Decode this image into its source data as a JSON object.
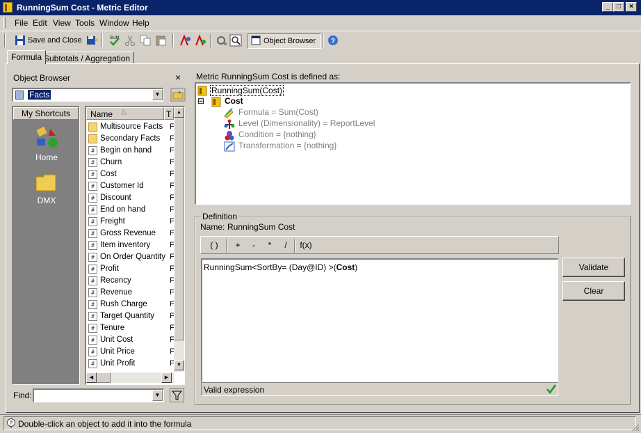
{
  "window": {
    "title": "RunningSum Cost - Metric Editor",
    "min_label": "_",
    "max_label": "□",
    "close_label": "×"
  },
  "menu": [
    {
      "label": "File"
    },
    {
      "label": "Edit"
    },
    {
      "label": "View"
    },
    {
      "label": "Tools"
    },
    {
      "label": "Window"
    },
    {
      "label": "Help"
    }
  ],
  "toolbar": {
    "save_close_label": "Save and Close",
    "object_browser_label": "Object Browser",
    "sum_label": "SUM"
  },
  "tabs": [
    {
      "label": "Formula",
      "active": true
    },
    {
      "label": "Subtotals / Aggregation",
      "active": false
    }
  ],
  "object_browser": {
    "title": "Object Browser",
    "close_label": "×",
    "folder_value": "Facts",
    "shortcuts_header": "My Shortcuts",
    "shortcuts": [
      {
        "label": "Home",
        "icon": "home-icon"
      },
      {
        "label": "DMX",
        "icon": "folder-icon"
      }
    ],
    "columns": [
      "Name",
      "T"
    ],
    "sort_glyph": "△",
    "items": [
      {
        "name": "Multisource Facts",
        "type": "F",
        "icon": "folder"
      },
      {
        "name": "Secondary Facts",
        "type": "F",
        "icon": "folder"
      },
      {
        "name": "Begin on hand",
        "type": "F",
        "icon": "fact"
      },
      {
        "name": "Churn",
        "type": "F",
        "icon": "fact"
      },
      {
        "name": "Cost",
        "type": "F",
        "icon": "fact"
      },
      {
        "name": "Customer Id",
        "type": "F",
        "icon": "fact"
      },
      {
        "name": "Discount",
        "type": "F",
        "icon": "fact"
      },
      {
        "name": "End on hand",
        "type": "F",
        "icon": "fact"
      },
      {
        "name": "Freight",
        "type": "F",
        "icon": "fact"
      },
      {
        "name": "Gross Revenue",
        "type": "F",
        "icon": "fact"
      },
      {
        "name": "Item inventory",
        "type": "F",
        "icon": "fact"
      },
      {
        "name": "On Order Quantity",
        "type": "F",
        "icon": "fact"
      },
      {
        "name": "Profit",
        "type": "F",
        "icon": "fact"
      },
      {
        "name": "Recency",
        "type": "F",
        "icon": "fact"
      },
      {
        "name": "Revenue",
        "type": "F",
        "icon": "fact"
      },
      {
        "name": "Rush Charge",
        "type": "F",
        "icon": "fact"
      },
      {
        "name": "Target Quantity",
        "type": "F",
        "icon": "fact"
      },
      {
        "name": "Tenure",
        "type": "F",
        "icon": "fact"
      },
      {
        "name": "Unit Cost",
        "type": "F",
        "icon": "fact"
      },
      {
        "name": "Unit Price",
        "type": "F",
        "icon": "fact"
      },
      {
        "name": "Unit Profit",
        "type": "F",
        "icon": "fact"
      }
    ],
    "fact_glyph": "#",
    "find_label": "Find:",
    "find_value": ""
  },
  "metric": {
    "header_prefix": "Metric",
    "name": "RunningSum Cost",
    "header_suffix": "is defined as:",
    "tree_root": "RunningSum(Cost)",
    "tree_toggle": "⊟",
    "tree_child": "Cost",
    "properties": [
      {
        "label": "Formula = Sum(Cost)",
        "icon": "formula-icon"
      },
      {
        "label": "Level (Dimensionality) = ReportLevel",
        "icon": "level-icon"
      },
      {
        "label": "Condition = {nothing}",
        "icon": "condition-icon"
      },
      {
        "label": "Transformation = {nothing}",
        "icon": "transformation-icon"
      }
    ]
  },
  "definition": {
    "group_label": "Definition",
    "name_label": "Name:",
    "name_value": "RunningSum Cost",
    "operators": [
      "( )",
      "+",
      "-",
      "*",
      "/",
      "f(x)"
    ],
    "formula_prefix": "RunningSum<SortBy= (Day@ID) >(",
    "formula_bold": "Cost",
    "formula_suffix": ")",
    "status": "Valid expression",
    "validate_label": "Validate",
    "clear_label": "Clear"
  },
  "statusbar": {
    "text": "Double-click an object to add it into the formula"
  }
}
